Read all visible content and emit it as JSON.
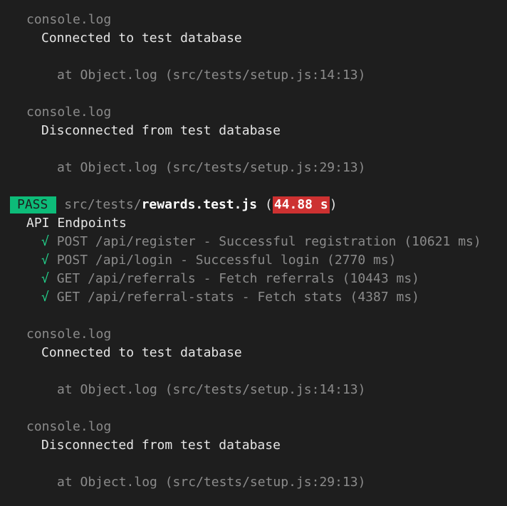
{
  "blocks": {
    "log1": {
      "label": "console.log",
      "message": "Connected to test database",
      "location": "at Object.log (src/tests/setup.js:14:13)"
    },
    "log2": {
      "label": "console.log",
      "message": "Disconnected from test database",
      "location": "at Object.log (src/tests/setup.js:29:13)"
    },
    "log3": {
      "label": "console.log",
      "message": "Connected to test database",
      "location": "at Object.log (src/tests/setup.js:14:13)"
    },
    "log4": {
      "label": "console.log",
      "message": "Disconnected from test database",
      "location": "at Object.log (src/tests/setup.js:29:13)"
    }
  },
  "result": {
    "status": "PASS",
    "path_prefix": "src/tests/",
    "file_name": "rewards.test.js",
    "open_paren": "(",
    "duration": "44.88 s",
    "close_paren": ")"
  },
  "suite": {
    "name": "API Endpoints",
    "tests": [
      {
        "check": "√",
        "text": "POST /api/register - Successful registration (10621 ms)"
      },
      {
        "check": "√",
        "text": "POST /api/login - Successful login (2770 ms)"
      },
      {
        "check": "√",
        "text": "GET /api/referrals - Fetch referrals (10443 ms)"
      },
      {
        "check": "√",
        "text": "GET /api/referral-stats - Fetch stats (4387 ms)"
      }
    ]
  },
  "colors": {
    "background": "#1e1e1e",
    "pass_badge": "#0dbc79",
    "time_badge": "#cd3131",
    "check_mark": "#23d18b"
  }
}
